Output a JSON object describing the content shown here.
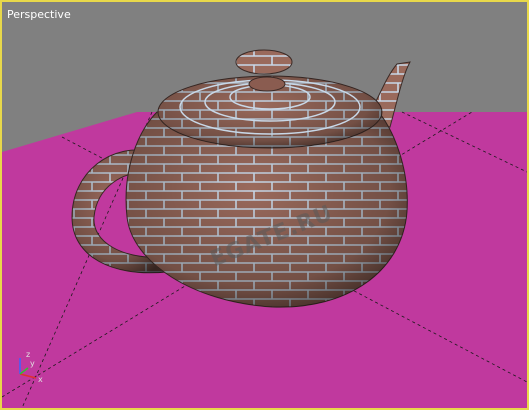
{
  "viewport": {
    "label": "Perspective",
    "frame_color": "#e8d84a",
    "background_color": "#808080",
    "ground_color": "#c0399e",
    "grid_line_color": "#1a1a1a"
  },
  "watermark": {
    "text": "EGATE.RU"
  },
  "axis_gizmo": {
    "x_label": "x",
    "y_label": "y",
    "z_label": "z",
    "x_color": "#e03030",
    "y_color": "#30c030",
    "z_color": "#4060ff"
  },
  "object": {
    "name_icon": "teapot-brick-material",
    "brick_color": "#9a6a5c",
    "mortar_color": "#c8d8e8"
  }
}
